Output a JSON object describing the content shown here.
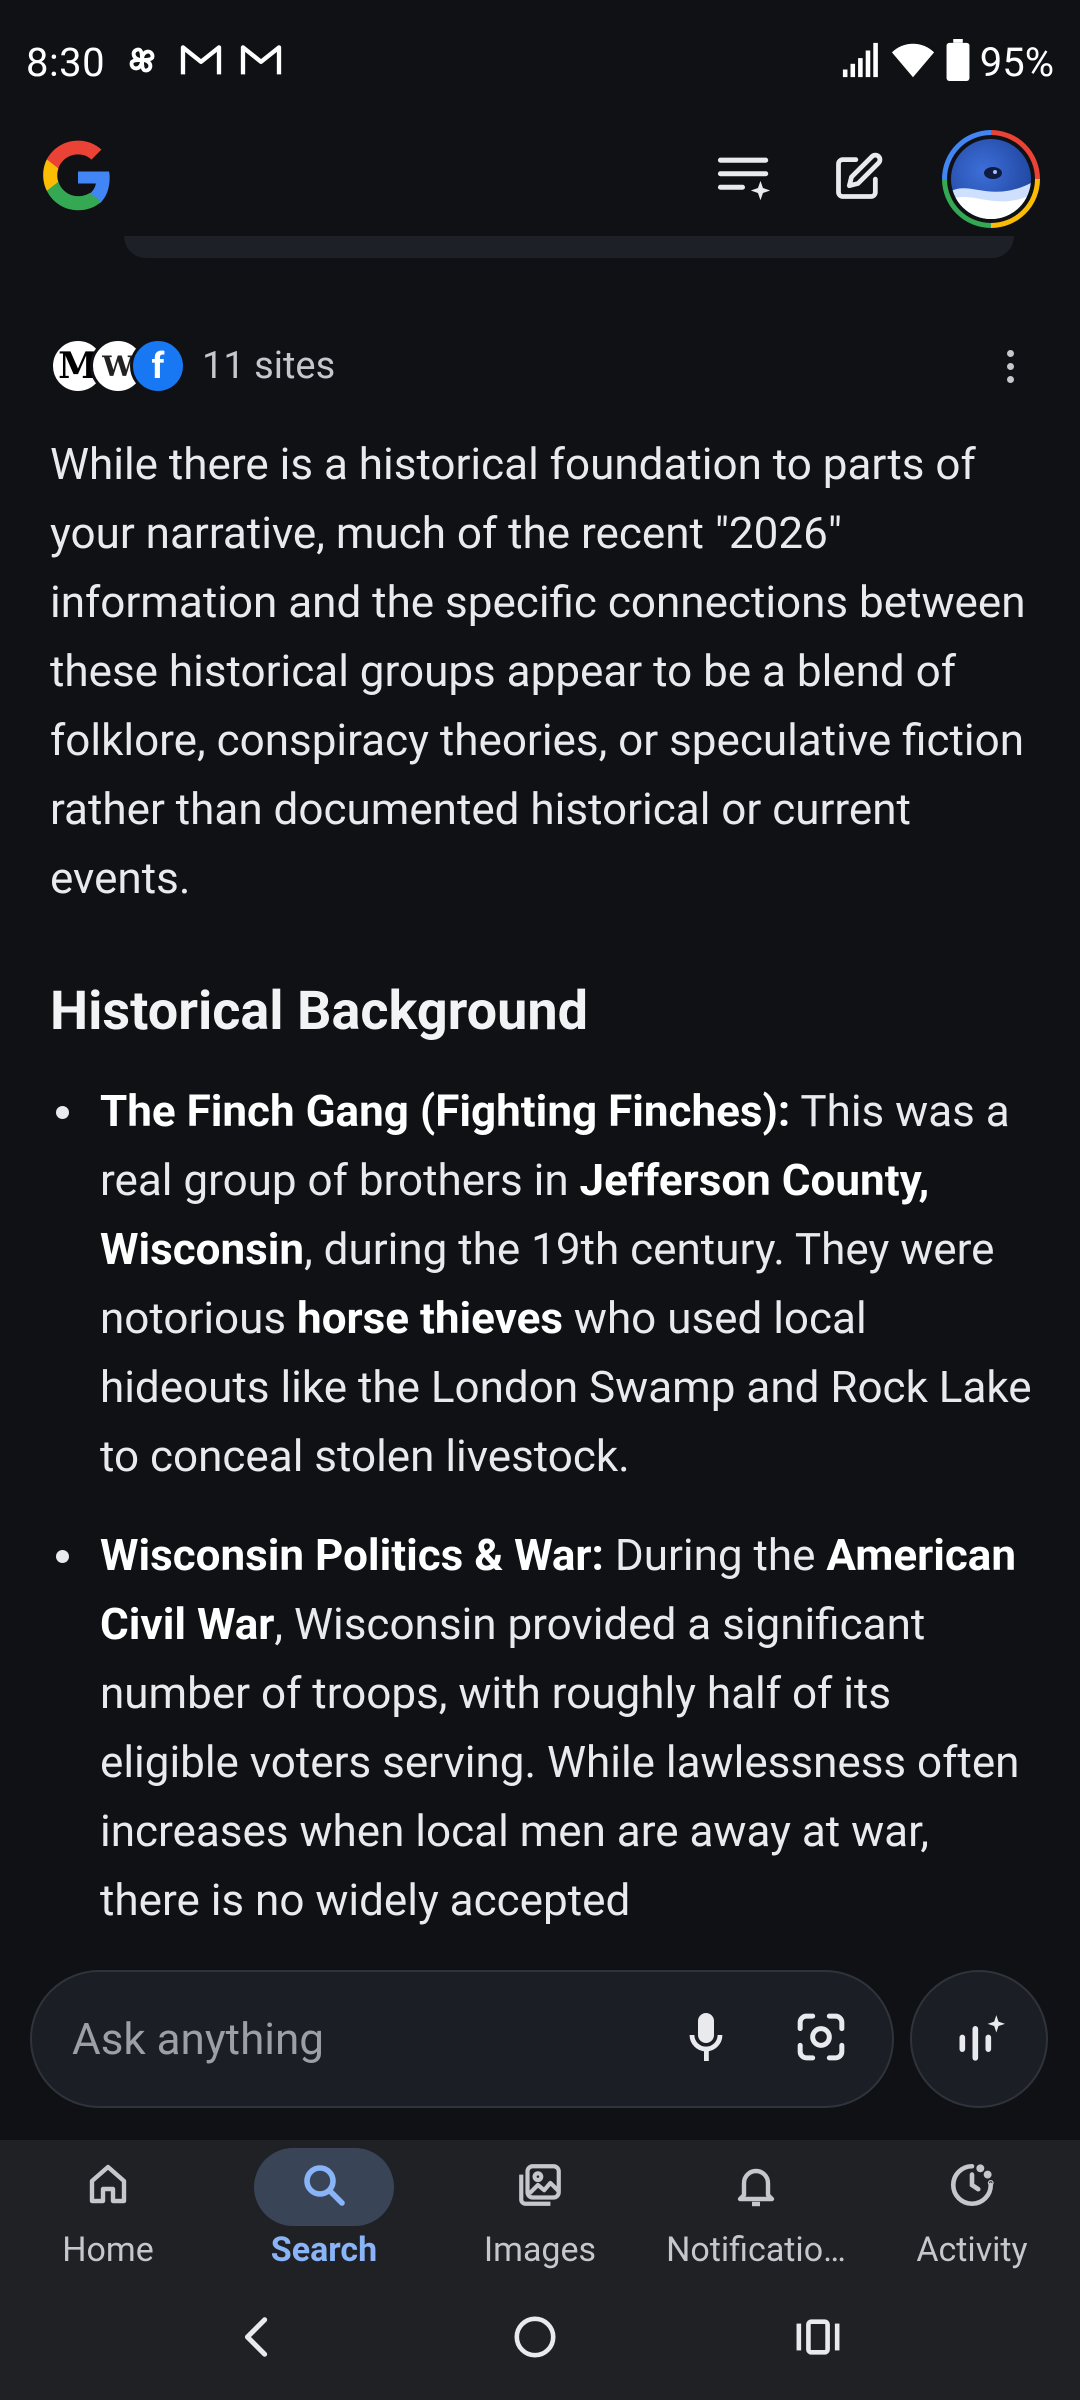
{
  "status_bar": {
    "time": "8:30",
    "left_icons": [
      "pinwheel-icon",
      "gmail-icon",
      "gmail-icon"
    ],
    "right_icons": [
      "signal-icon",
      "wifi-icon",
      "battery-icon"
    ],
    "battery_percent": "95%"
  },
  "app_bar": {
    "logo": "google-logo",
    "actions": [
      "history-icon",
      "edit-icon"
    ],
    "avatar": "profile-avatar"
  },
  "sources": {
    "icons": [
      "M",
      "W",
      "f"
    ],
    "count_label": "11 sites"
  },
  "answer": {
    "intro": "While there is a historical foundation to parts of your narrative, much of the recent \"2026\" information and the specific connections between these historical groups appear to be a blend of folklore, conspiracy theories, or speculative fiction rather than documented historical or current events.",
    "heading": "Historical Background",
    "bullets": [
      {
        "title": "The Finch Gang (Fighting Finches):",
        "t1": " This was a real group of brothers in ",
        "b1": "Jefferson County, Wisconsin",
        "t2": ", during the 19th century. They were notorious ",
        "b2": "horse thieves",
        "t3": " who used local hideouts like the London Swamp and Rock Lake to conceal stolen livestock."
      },
      {
        "title": "Wisconsin Politics & War:",
        "t1": " During the ",
        "b1": "American Civil War",
        "t2": ", Wisconsin provided a significant number of troops, with roughly half of its eligible voters serving. While lawlessness often increases when local men are away at war, there is no widely accepted"
      }
    ]
  },
  "ask_bar": {
    "placeholder": "Ask anything",
    "icons": [
      "mic-icon",
      "lens-camera-icon"
    ],
    "voice_mode_icon": "voice-sparkle-icon"
  },
  "bottom_nav": {
    "items": [
      {
        "label": "Home",
        "icon": "home-icon"
      },
      {
        "label": "Search",
        "icon": "search-icon"
      },
      {
        "label": "Images",
        "icon": "images-icon"
      },
      {
        "label": "Notificatio…",
        "icon": "bell-icon"
      },
      {
        "label": "Activity",
        "icon": "activity-icon"
      }
    ],
    "active": "Search"
  },
  "system_nav": [
    "back-icon",
    "home-circle-icon",
    "recents-icon"
  ],
  "colors": {
    "background": "#0f1115",
    "accent": "#8ab4f8",
    "active_pill": "#394457",
    "nav_background": "#202124"
  }
}
